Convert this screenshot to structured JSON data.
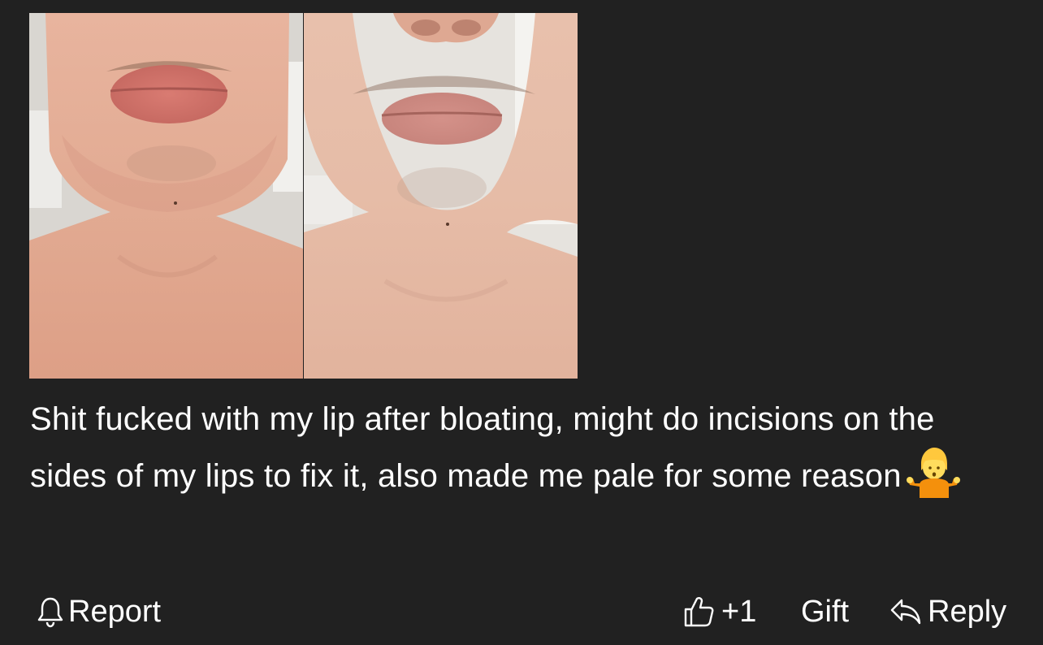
{
  "post": {
    "images": [
      {
        "alt": "",
        "icon": "photo-before"
      },
      {
        "alt": "",
        "icon": "photo-after"
      }
    ],
    "body_text": "Shit fucked with my lip after bloating, might do incisions on the sides of my lips to fix it, also made me pale for some reason",
    "emoji": "🤷",
    "emoji_icon": "person-shrugging-emoji"
  },
  "actions": {
    "report": {
      "label": "Report",
      "icon": "bell-icon"
    },
    "like": {
      "label": "+1",
      "icon": "thumbs-up-icon"
    },
    "gift": {
      "label": "Gift"
    },
    "reply": {
      "label": "Reply",
      "icon": "reply-arrow-icon"
    }
  },
  "colors": {
    "background": "#212121",
    "text": "#ffffff"
  }
}
